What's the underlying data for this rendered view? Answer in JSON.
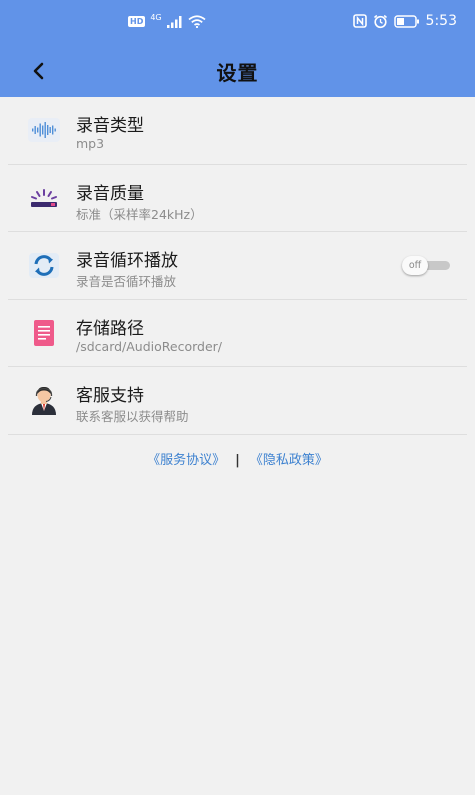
{
  "status_bar": {
    "hd": "HD",
    "network": "4G",
    "time": "5:53"
  },
  "nav": {
    "title": "设置",
    "back_icon": "chevron-left-icon"
  },
  "settings": [
    {
      "title": "录音类型",
      "subtitle": "mp3",
      "icon": "waveform-icon"
    },
    {
      "title": "录音质量",
      "subtitle": "标准（采样率24kHz）",
      "icon": "quality-icon"
    },
    {
      "title": "录音循环播放",
      "subtitle": "录音是否循环播放",
      "icon": "loop-icon",
      "toggle_label": "off",
      "toggle_on": false
    },
    {
      "title": "存储路径",
      "subtitle": "/sdcard/AudioRecorder/",
      "icon": "document-icon"
    },
    {
      "title": "客服支持",
      "subtitle": "联系客服以获得帮助",
      "icon": "support-agent-icon"
    }
  ],
  "links": {
    "service": "《服务协议》",
    "separator": "|",
    "privacy": "《隐私政策》"
  },
  "colors": {
    "header": "#6193e8",
    "link": "#3e82d0",
    "background": "#f1f1f1"
  }
}
